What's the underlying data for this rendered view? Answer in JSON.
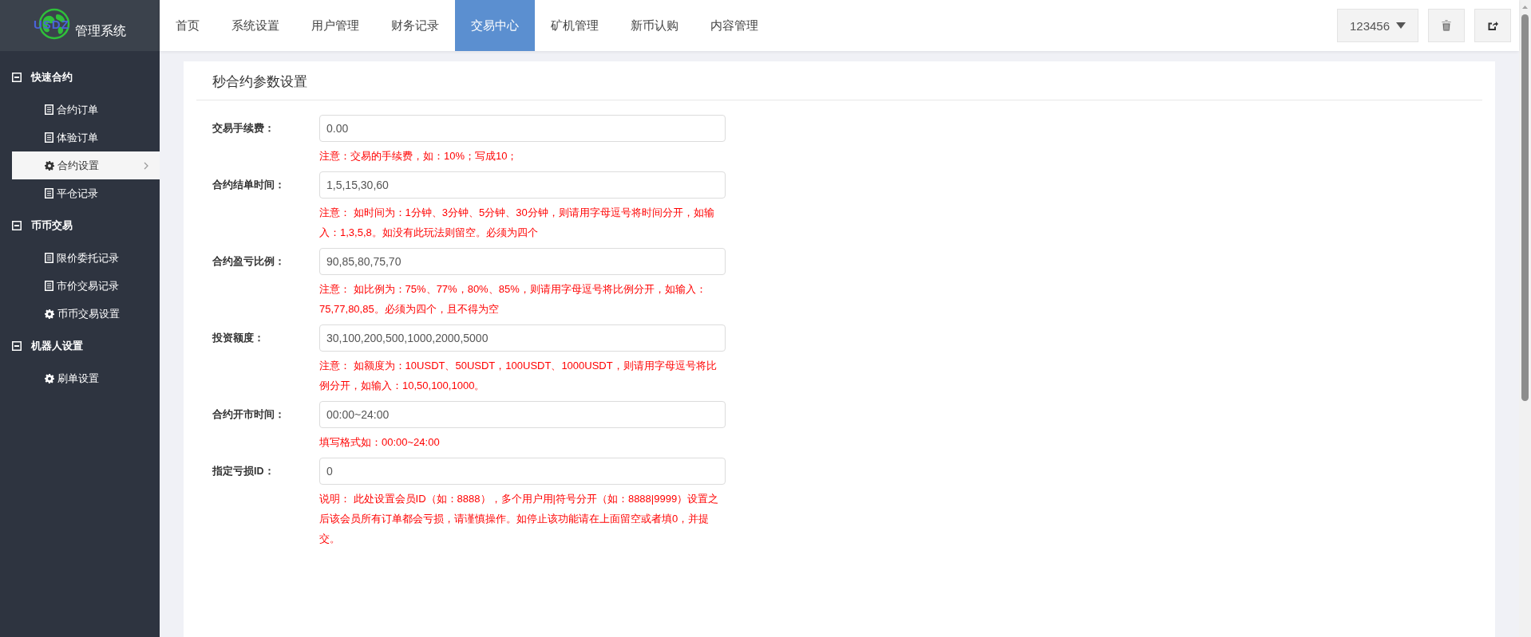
{
  "logo": {
    "mark": "USDZ",
    "text": "管理系统"
  },
  "nav": [
    {
      "label": "首页",
      "selected": false
    },
    {
      "label": "系统设置",
      "selected": false
    },
    {
      "label": "用户管理",
      "selected": false
    },
    {
      "label": "财务记录",
      "selected": false
    },
    {
      "label": "交易中心",
      "selected": true
    },
    {
      "label": "矿机管理",
      "selected": false
    },
    {
      "label": "新币认购",
      "selected": false
    },
    {
      "label": "内容管理",
      "selected": false
    }
  ],
  "user_menu": {
    "label": "123456"
  },
  "sidebar": {
    "groups": [
      {
        "title": "快速合约",
        "expanded": true,
        "items": [
          {
            "label": "合约订单",
            "kind": "list",
            "selected": false
          },
          {
            "label": "体验订单",
            "kind": "list",
            "selected": false
          },
          {
            "label": "合约设置",
            "kind": "gear",
            "selected": true
          },
          {
            "label": "平仓记录",
            "kind": "list",
            "selected": false
          }
        ]
      },
      {
        "title": "币币交易",
        "expanded": true,
        "items": [
          {
            "label": "限价委托记录",
            "kind": "list",
            "selected": false
          },
          {
            "label": "市价交易记录",
            "kind": "list",
            "selected": false
          },
          {
            "label": "币币交易设置",
            "kind": "gear",
            "selected": false
          }
        ]
      },
      {
        "title": "机器人设置",
        "expanded": true,
        "items": [
          {
            "label": "刷单设置",
            "kind": "gear",
            "selected": false
          }
        ]
      }
    ]
  },
  "form": {
    "title": "秒合约参数设置",
    "fields": [
      {
        "label": "交易手续费：",
        "value": "0.00",
        "note": "注意：交易的手续费，如：10%；写成10；"
      },
      {
        "label": "合约结单时间：",
        "value": "1,5,15,30,60",
        "note": "注意： 如时间为：1分钟、3分钟、5分钟、30分钟，则请用字母逗号将时间分开，如输入：1,3,5,8。如没有此玩法则留空。必须为四个"
      },
      {
        "label": "合约盈亏比例：",
        "value": "90,85,80,75,70",
        "note": "注意： 如比例为：75%、77%，80%、85%，则请用字母逗号将比例分开，如输入：75,77,80,85。必须为四个，且不得为空"
      },
      {
        "label": "投资额度：",
        "value": "30,100,200,500,1000,2000,5000",
        "note": "注意： 如额度为：10USDT、50USDT，100USDT、1000USDT，则请用字母逗号将比例分开，如输入：10,50,100,1000。"
      },
      {
        "label": "合约开市时间：",
        "value": "00:00~24:00",
        "note": "填写格式如：00:00~24:00"
      },
      {
        "label": "指定亏损ID：",
        "value": "0",
        "note": "说明： 此处设置会员ID（如：8888），多个用户用|符号分开（如：8888|9999）设置之后该会员所有订单都会亏损，请谨慎操作。如停止该功能请在上面留空或者填0，并提交。"
      }
    ]
  }
}
